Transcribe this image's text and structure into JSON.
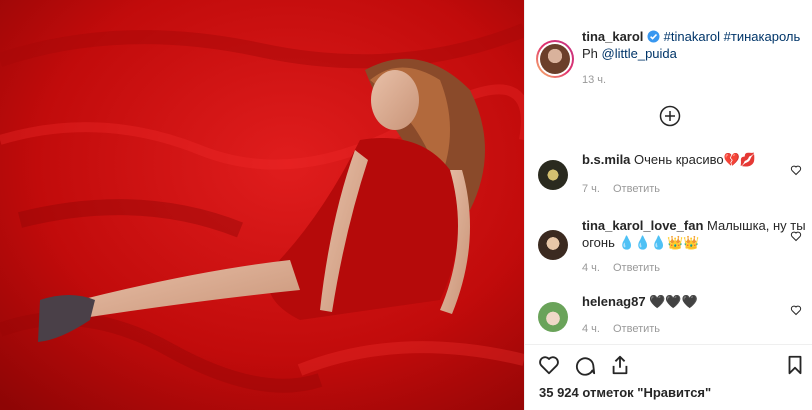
{
  "post": {
    "author": "tina_karol",
    "verified": true,
    "hashtags": "#tinakarol #тинакароль",
    "credit_prefix": "Ph",
    "credit_user": "@little_puida",
    "time": "13 ч."
  },
  "comments": [
    {
      "user": "b.s.mila",
      "text": "Очень красиво💔💋",
      "time": "7 ч.",
      "reply": "Ответить"
    },
    {
      "user": "tina_karol_love_fan",
      "text_line1": "Малышка, ну ты",
      "text_line2": "огонь 💧💧💧👑👑",
      "time": "4 ч.",
      "reply": "Ответить"
    },
    {
      "user": "helenag87",
      "text": "🖤🖤🖤",
      "time": "4 ч.",
      "reply": "Ответить"
    }
  ],
  "likes": "35 924 отметок \"Нравится\"",
  "colors": {
    "photo_red": "#c30c0c",
    "link": "#003569",
    "verified": "#3897f0",
    "muted": "#999999"
  },
  "icons": [
    "verified-badge-icon",
    "load-more-icon",
    "heart-icon",
    "comment-icon",
    "share-icon",
    "bookmark-icon"
  ]
}
